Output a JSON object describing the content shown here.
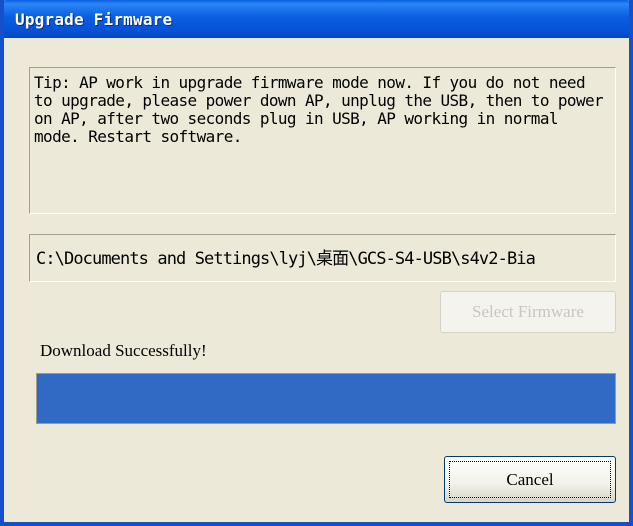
{
  "window": {
    "title": "Upgrade Firmware"
  },
  "tip": {
    "text": "Tip: AP work in upgrade firmware mode now. If you do not need to upgrade, please power down AP, unplug the USB, then to power on AP, after two seconds plug in USB, AP working in normal mode. Restart software."
  },
  "firmware": {
    "path": "C:\\Documents and Settings\\lyj\\桌面\\GCS-S4-USB\\s4v2-Bia",
    "select_label": "Select Firmware"
  },
  "status": {
    "text": "Download Successfully!"
  },
  "progress": {
    "value_percent": 100,
    "fill_color": "#316ac5"
  },
  "cancel": {
    "label": "Cancel"
  }
}
